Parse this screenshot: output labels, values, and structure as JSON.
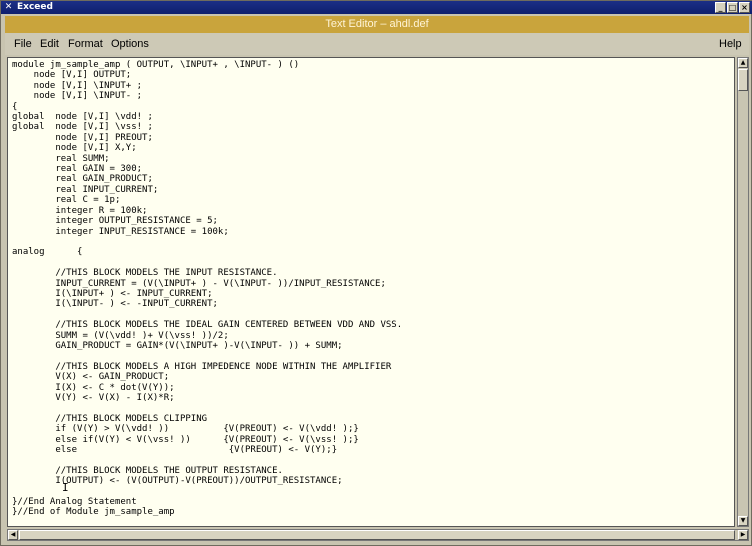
{
  "outer_window": {
    "title": "Exceed",
    "icon": "x-logo-icon"
  },
  "outer_controls": {
    "minimize": "_",
    "maximize": "□",
    "close": "×"
  },
  "window": {
    "title": "Text Editor – ahdl.def"
  },
  "menu": {
    "file": "File",
    "edit": "Edit",
    "format": "Format",
    "options": "Options",
    "help": "Help"
  },
  "editor": {
    "content": "module jm_sample_amp ( OUTPUT, \\INPUT+ , \\INPUT- ) ()\n    node [V,I] OUTPUT;\n    node [V,I] \\INPUT+ ;\n    node [V,I] \\INPUT- ;\n{\nglobal  node [V,I] \\vdd! ;\nglobal  node [V,I] \\vss! ;\n        node [V,I] PREOUT;\n        node [V,I] X,Y;\n        real SUMM;\n        real GAIN = 300;\n        real GAIN_PRODUCT;\n        real INPUT_CURRENT;\n        real C = 1p;\n        integer R = 100k;\n        integer OUTPUT_RESISTANCE = 5;\n        integer INPUT_RESISTANCE = 100k;\n\nanalog      {\n\n        //THIS BLOCK MODELS THE INPUT RESISTANCE.\n        INPUT_CURRENT = (V(\\INPUT+ ) - V(\\INPUT- ))/INPUT_RESISTANCE;\n        I(\\INPUT+ ) <- INPUT_CURRENT;\n        I(\\INPUT- ) <- -INPUT_CURRENT;\n\n        //THIS BLOCK MODELS THE IDEAL GAIN CENTERED BETWEEN VDD AND VSS.\n        SUMM = (V(\\vdd! )+ V(\\vss! ))/2;\n        GAIN_PRODUCT = GAIN*(V(\\INPUT+ )-V(\\INPUT- )) + SUMM;\n\n        //THIS BLOCK MODELS A HIGH IMPEDENCE NODE WITHIN THE AMPLIFIER\n        V(X) <- GAIN_PRODUCT;\n        I(X) <- C * dot(V(Y));\n        V(Y) <- V(X) - I(X)*R;\n\n        //THIS BLOCK MODELS CLIPPING\n        if (V(Y) > V(\\vdd! ))          {V(PREOUT) <- V(\\vdd! );}\n        else if(V(Y) < V(\\vss! ))      {V(PREOUT) <- V(\\vss! );}\n        else                            {V(PREOUT) <- V(Y);}\n\n        //THIS BLOCK MODELS THE OUTPUT RESISTANCE.\n        I(OUTPUT) <- (V(OUTPUT)-V(PREOUT))/OUTPUT_RESISTANCE;\n\n}//End Analog Statement\n}//End of Module jm_sample_amp"
  },
  "scrollbars": {
    "up": "▲",
    "down": "▼",
    "left": "◀",
    "right": "▶"
  },
  "cursor_glyph": "I"
}
